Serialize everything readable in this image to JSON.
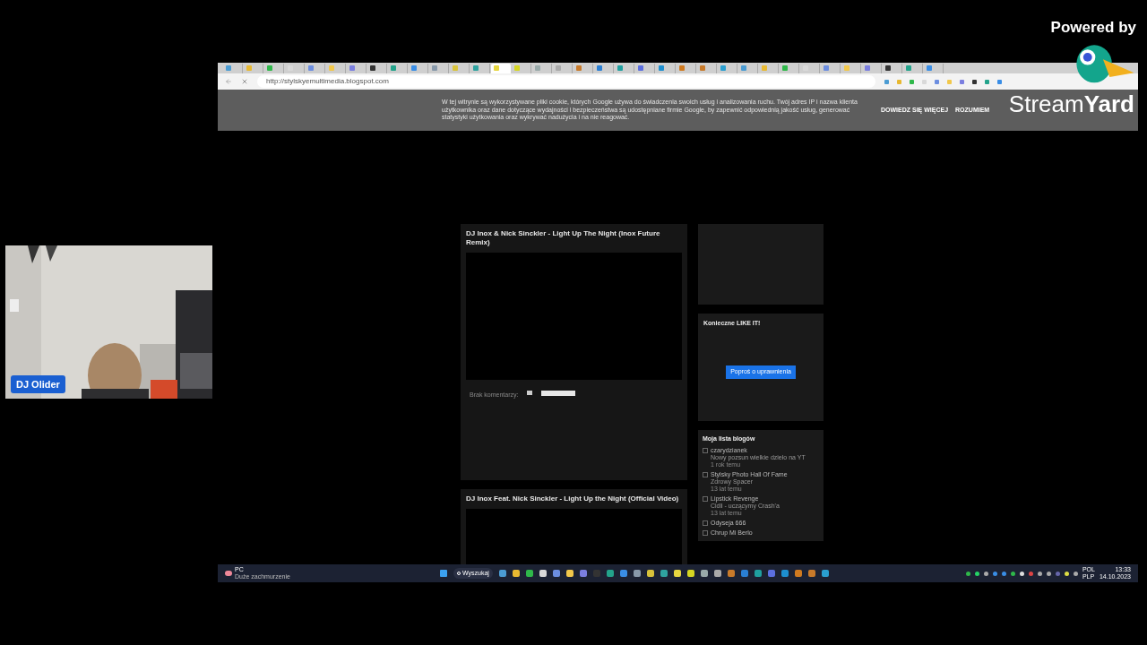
{
  "branding": {
    "powered_by": "Powered by",
    "logo_text": "Stream",
    "logo_bold": "Yard"
  },
  "webcam": {
    "name": "DJ Olider"
  },
  "browser": {
    "tabs": [
      {
        "selected": false
      },
      {
        "selected": false
      },
      {
        "selected": false
      },
      {
        "selected": false
      },
      {
        "selected": false
      },
      {
        "selected": false
      },
      {
        "selected": false
      },
      {
        "selected": false
      },
      {
        "selected": false
      },
      {
        "selected": false
      },
      {
        "selected": false
      },
      {
        "selected": false
      },
      {
        "selected": false
      },
      {
        "selected": true
      },
      {
        "selected": false
      },
      {
        "selected": false
      },
      {
        "selected": false
      },
      {
        "selected": false
      },
      {
        "selected": false
      },
      {
        "selected": false
      },
      {
        "selected": false
      },
      {
        "selected": false
      },
      {
        "selected": false
      },
      {
        "selected": false
      },
      {
        "selected": false
      },
      {
        "selected": false
      },
      {
        "selected": false
      },
      {
        "selected": false
      },
      {
        "selected": false
      },
      {
        "selected": false
      },
      {
        "selected": false
      },
      {
        "selected": false
      },
      {
        "selected": false
      },
      {
        "selected": false
      },
      {
        "selected": false
      }
    ],
    "url": "http://stylskyemultimedia.blogspot.com"
  },
  "cookie_banner": {
    "text": "W tej witrynie są wykorzystywane pliki cookie, których Google używa do świadczenia swoich usług i analizowania ruchu. Twój adres IP i nazwa klienta użytkownika oraz dane dotyczące wydajności i bezpieczeństwa są udostępniane firmie Google, by zapewnić odpowiednią jakość usług, generować statystyki użytkowania oraz wykrywać nadużycia i na nie reagować.",
    "buttons": [
      "DOWIEDZ SIĘ WIĘCEJ",
      "ROZUMIEM"
    ]
  },
  "posts": [
    {
      "title": "DJ Inox & Nick Sinckler - Light Up The Night (Inox Future Remix)",
      "comments": "Brak komentarzy:"
    },
    {
      "title": "DJ Inox Feat. Nick Sinckler - Light Up the Night (Official Video)"
    }
  ],
  "sidebar": {
    "widget_title": "Konieczne LIKE IT!",
    "widget_button": "Poproś o uprawnienia",
    "blog_list_title": "Moja lista blogów",
    "blogs": [
      {
        "name": "czarydzianek",
        "post": "Nowy pozsun wielkie dzieło na YT",
        "age": "1 rok temu"
      },
      {
        "name": "Stylsky Photo Hall Of Fame",
        "post": "Zdrowy Spacer",
        "age": "13 lat temu"
      },
      {
        "name": "Lipstick Revenge",
        "post": "Cidli - uczącymy Crash'a",
        "age": "13 lat temu"
      },
      {
        "name": "Odyseja 666"
      },
      {
        "name": "Chrup Mi Berlo"
      }
    ]
  },
  "taskbar": {
    "weather_title": "PC",
    "weather_sub": "Duże zachmurzenie",
    "search": "Wyszukaj",
    "language": "POL",
    "layout": "PLP",
    "time": "13:33",
    "date": "14.10.2023"
  }
}
